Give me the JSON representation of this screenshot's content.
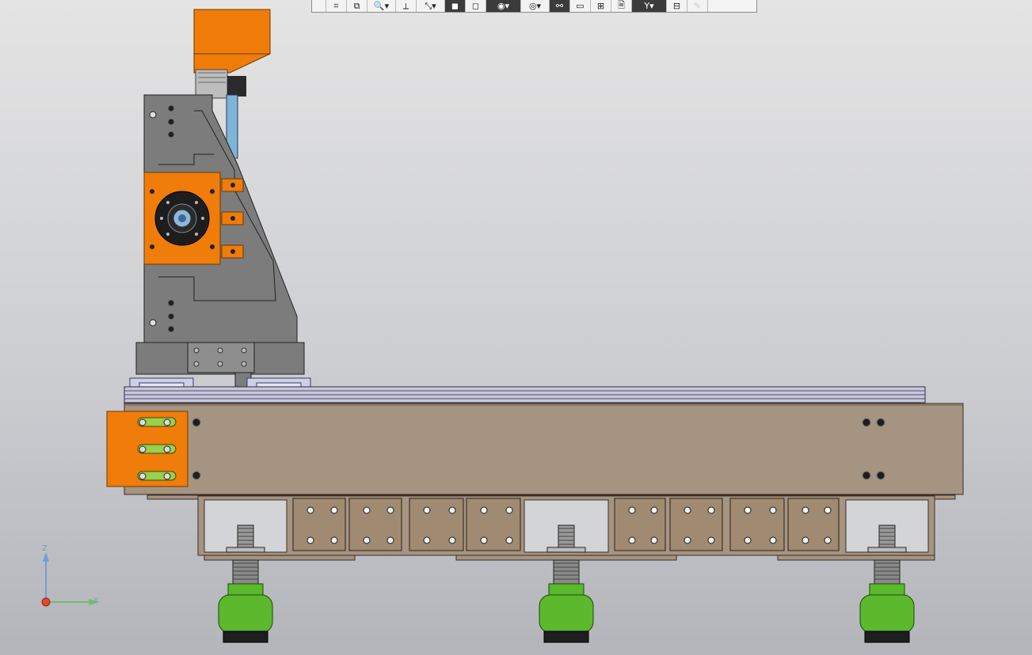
{
  "toolbar": {
    "buttons": [
      {
        "name": "toolbar-edge-button",
        "icon": "edge-icon",
        "glyph": "",
        "style": "w18",
        "interactable": true
      },
      {
        "name": "select-filter-button",
        "icon": "filter-frame-icon",
        "glyph": "⌗",
        "style": "w26",
        "interactable": true
      },
      {
        "name": "section-view-button",
        "icon": "section-view-icon",
        "glyph": "⧉",
        "style": "w26",
        "interactable": true
      },
      {
        "name": "zoom-button",
        "icon": "zoom-icon",
        "glyph": "🔍▾",
        "style": "w36",
        "interactable": true
      },
      {
        "name": "orientation-button",
        "icon": "orientation-icon",
        "glyph": "⟂",
        "style": "w26",
        "interactable": true
      },
      {
        "name": "axes-dropdown-button",
        "icon": "axes-icon",
        "glyph": "⤡▾",
        "style": "w36",
        "interactable": true
      },
      {
        "name": "shaded-display-button",
        "icon": "shaded-cube-icon",
        "glyph": "◼",
        "style": "w26 dark",
        "interactable": true
      },
      {
        "name": "wireframe-display-button",
        "icon": "wireframe-cube-icon",
        "glyph": "◻",
        "style": "w26",
        "interactable": true
      },
      {
        "name": "hide-show-dropdown-button",
        "icon": "eye-icon",
        "glyph": "◉▾",
        "style": "w44 dark",
        "interactable": true
      },
      {
        "name": "visibility-dropdown-button",
        "icon": "eye-outline-icon",
        "glyph": "◎▾",
        "style": "w36",
        "interactable": true
      },
      {
        "name": "connections-button",
        "icon": "connections-icon",
        "glyph": "⚯",
        "style": "w26 dark",
        "interactable": true
      },
      {
        "name": "component-button",
        "icon": "component-icon",
        "glyph": "▭",
        "style": "w26",
        "interactable": true
      },
      {
        "name": "parts-button",
        "icon": "parts-icon",
        "glyph": "⊞",
        "style": "w26",
        "interactable": true
      },
      {
        "name": "document-button",
        "icon": "document-icon",
        "glyph": "🗎",
        "style": "w26",
        "interactable": true
      },
      {
        "name": "filter-dropdown-button",
        "icon": "funnel-icon",
        "glyph": "Y▾",
        "style": "w44 dark",
        "interactable": true
      },
      {
        "name": "measure-button",
        "icon": "measure-icon",
        "glyph": "⊟",
        "style": "w26",
        "interactable": true
      },
      {
        "name": "pen-button",
        "icon": "pen-icon",
        "glyph": "✎",
        "style": "w26 disabled",
        "interactable": true
      }
    ]
  },
  "axes": {
    "z_label": "Z",
    "y_label": "Y",
    "z_color": "#6f9fd8",
    "y_color": "#6fbf6f",
    "origin_color": "#e04a2a"
  },
  "colors": {
    "orange": "#f07c0a",
    "steel": "#7c7c7c",
    "frame": "#a59482",
    "frame_dark": "#8a7a68",
    "rail": "#c8c8d8",
    "foot_green": "#5cb82c",
    "foot_black": "#1e1e1e",
    "hardware": "#9a9a9a"
  }
}
